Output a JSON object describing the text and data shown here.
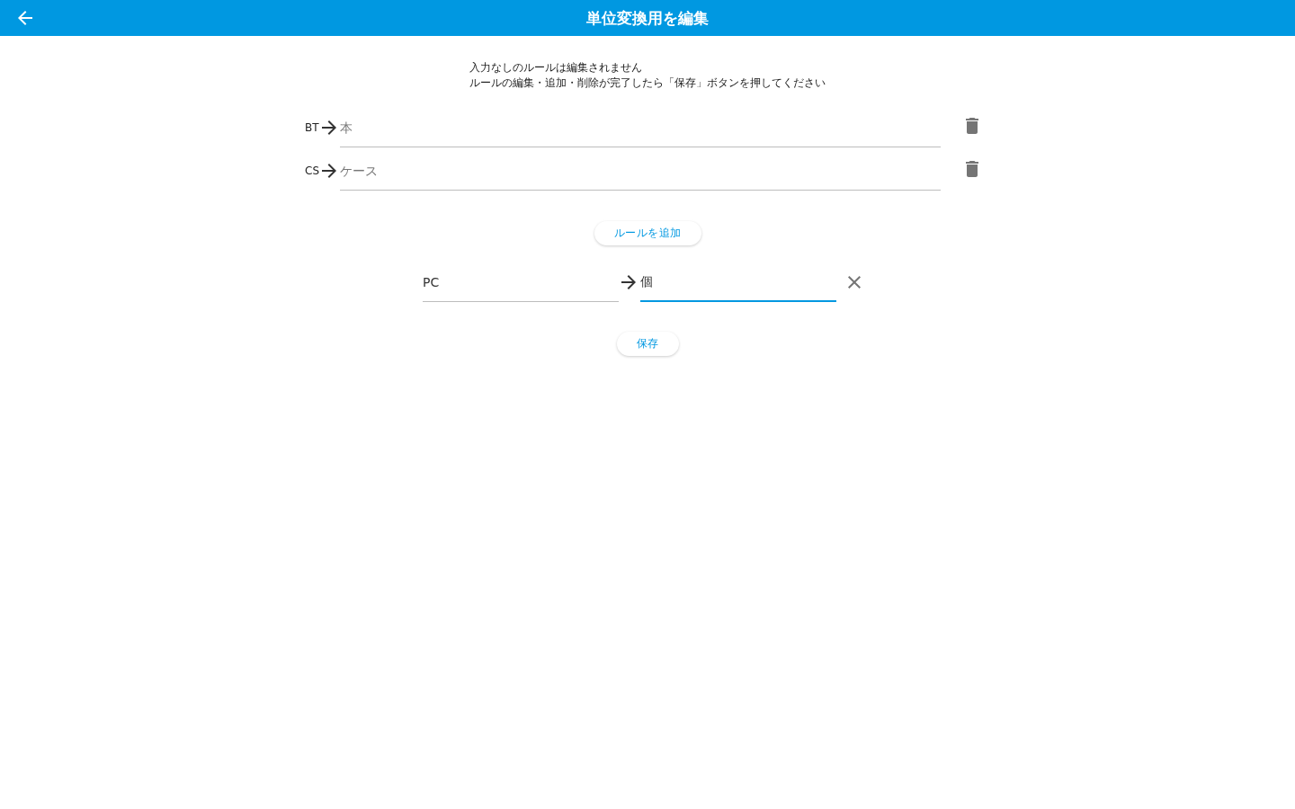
{
  "app_bar": {
    "title": "単位変換用を編集"
  },
  "notes": [
    "入力なしのルールは編集されません",
    "ルールの編集・追加・削除が完了したら「保存」ボタンを押してください"
  ],
  "rules": [
    {
      "from": "BT",
      "to": {
        "placeholder": "本"
      }
    },
    {
      "from": "CS",
      "to": {
        "placeholder": "ケース"
      }
    }
  ],
  "add_rule_button": "ルールを追加",
  "new_rule": {
    "from": {
      "value": "PC",
      "focused": false
    },
    "to": {
      "value": "個",
      "focused": true
    }
  },
  "save_button": "保存"
}
